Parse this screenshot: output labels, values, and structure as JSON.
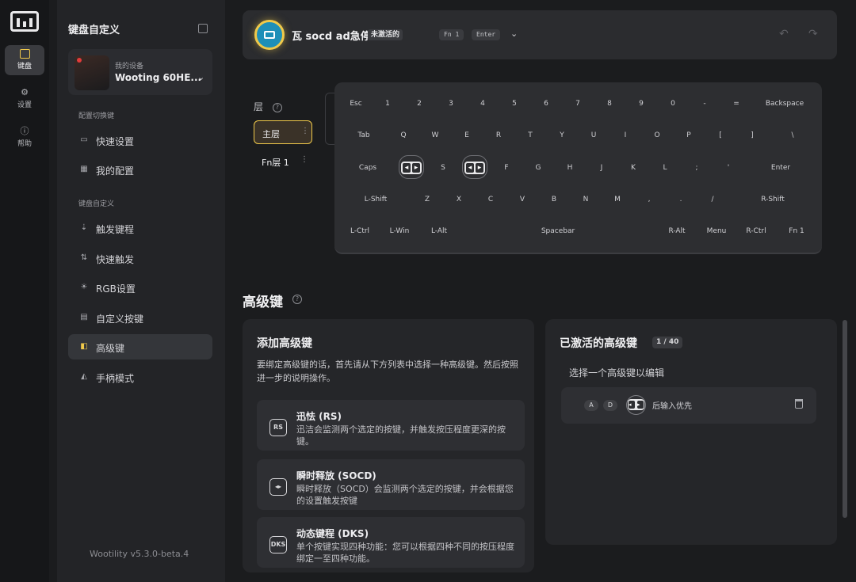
{
  "rail": {
    "items": [
      {
        "label": "键盘",
        "icon": "keyboard-icon"
      },
      {
        "label": "设置",
        "icon": "gear-icon"
      },
      {
        "label": "帮助",
        "icon": "help-icon"
      }
    ]
  },
  "sidebar": {
    "title": "键盘自定义",
    "device": {
      "caption": "我的设备",
      "name": "Wooting 60HE..."
    },
    "section_profiles": "配置切换键",
    "profile_items": [
      {
        "label": "快速设置",
        "icon": "keyboard-small-icon"
      },
      {
        "label": "我的配置",
        "icon": "grid-icon"
      }
    ],
    "section_custom": "键盘自定义",
    "custom_items": [
      {
        "label": "触发键程",
        "icon": "actuation-icon"
      },
      {
        "label": "快速触发",
        "icon": "rapid-trigger-icon"
      },
      {
        "label": "RGB设置",
        "icon": "rgb-icon"
      },
      {
        "label": "自定义按键",
        "icon": "remap-icon"
      },
      {
        "label": "高级键",
        "icon": "advanced-keys-icon",
        "active": true
      },
      {
        "label": "手柄模式",
        "icon": "gamepad-icon"
      }
    ],
    "version": "Wootility v5.3.0-beta.4"
  },
  "header": {
    "title": "瓦 socd ad急停",
    "badge": "未激活的",
    "pills": [
      "Fn 1",
      "Enter"
    ],
    "accent": "#f0c94a"
  },
  "layers": {
    "label": "层",
    "items": [
      "主层",
      "Fn层 1"
    ]
  },
  "keyboard": {
    "rows": [
      [
        "Esc",
        "1",
        "2",
        "3",
        "4",
        "5",
        "6",
        "7",
        "8",
        "9",
        "0",
        "-",
        "=",
        "Backspace"
      ],
      [
        "Tab",
        "Q",
        "W",
        "E",
        "R",
        "T",
        "Y",
        "U",
        "I",
        "O",
        "P",
        "[",
        "]",
        "\\"
      ],
      [
        "Caps",
        "A",
        "S",
        "D",
        "F",
        "G",
        "H",
        "J",
        "K",
        "L",
        ";",
        "'",
        "Enter"
      ],
      [
        "L-Shift",
        "Z",
        "X",
        "C",
        "V",
        "B",
        "N",
        "M",
        ",",
        ".",
        "/",
        "R-Shift"
      ],
      [
        "L-Ctrl",
        "L-Win",
        "L-Alt",
        "Spacebar",
        "R-Alt",
        "Menu",
        "R-Ctrl",
        "Fn 1"
      ]
    ],
    "socd_keys": [
      "A",
      "D"
    ]
  },
  "advanced": {
    "title": "高级键",
    "add_panel": {
      "title": "添加高级键",
      "description": "要绑定高级键的话，首先请从下方列表中选择一种高级键。然后按照进一步的说明操作。",
      "cards": [
        {
          "title": "迅怯 (RS)",
          "description": "迅洁会监测两个选定的按键，并触发按压程度更深的按键。",
          "icon_text": "RS"
        },
        {
          "title": "瞬时释放 (SOCD)",
          "description": "瞬时释放（SOCD）会监测两个选定的按键，并会根据您的设置触发按键",
          "icon_text": "◂▸"
        },
        {
          "title": "动态键程 (DKS)",
          "description": "单个按键实现四种功能：您可以根据四种不同的按压程度绑定一至四种功能。",
          "icon_text": "DKS"
        }
      ]
    },
    "active_panel": {
      "title": "已激活的高级键",
      "count": "1 / 40",
      "hint": "选择一个高级键以编辑",
      "rows": [
        {
          "keys": [
            "A",
            "D"
          ],
          "label": "后输入优先"
        }
      ]
    }
  }
}
